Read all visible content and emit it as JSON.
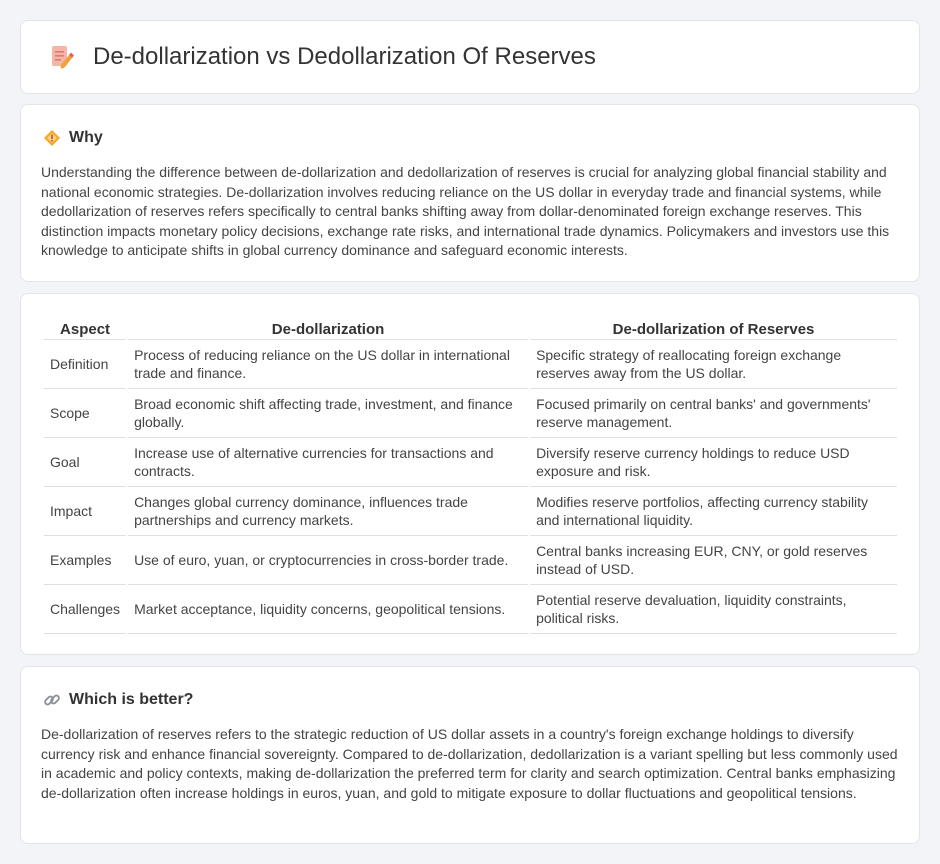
{
  "title": "De-dollarization vs Dedollarization Of Reserves",
  "why": {
    "heading": "Why",
    "body": "Understanding the difference between de-dollarization and dedollarization of reserves is crucial for analyzing global financial stability and national economic strategies. De-dollarization involves reducing reliance on the US dollar in everyday trade and financial systems, while dedollarization of reserves refers specifically to central banks shifting away from dollar-denominated foreign exchange reserves. This distinction impacts monetary policy decisions, exchange rate risks, and international trade dynamics. Policymakers and investors use this knowledge to anticipate shifts in global currency dominance and safeguard economic interests."
  },
  "table": {
    "headers": [
      "Aspect",
      "De-dollarization",
      "De-dollarization of Reserves"
    ],
    "rows": [
      [
        "Definition",
        "Process of reducing reliance on the US dollar in international trade and finance.",
        "Specific strategy of reallocating foreign exchange reserves away from the US dollar."
      ],
      [
        "Scope",
        "Broad economic shift affecting trade, investment, and finance globally.",
        "Focused primarily on central banks' and governments' reserve management."
      ],
      [
        "Goal",
        "Increase use of alternative currencies for transactions and contracts.",
        "Diversify reserve currency holdings to reduce USD exposure and risk."
      ],
      [
        "Impact",
        "Changes global currency dominance, influences trade partnerships and currency markets.",
        "Modifies reserve portfolios, affecting currency stability and international liquidity."
      ],
      [
        "Examples",
        "Use of euro, yuan, or cryptocurrencies in cross-border trade.",
        "Central banks increasing EUR, CNY, or gold reserves instead of USD."
      ],
      [
        "Challenges",
        "Market acceptance, liquidity concerns, geopolitical tensions.",
        "Potential reserve devaluation, liquidity constraints, political risks."
      ]
    ]
  },
  "better": {
    "heading": "Which is better?",
    "body": "De-dollarization of reserves refers to the strategic reduction of US dollar assets in a country's foreign exchange holdings to diversify currency risk and enhance financial sovereignty. Compared to de-dollarization, dedollarization is a variant spelling but less commonly used in academic and policy contexts, making de-dollarization the preferred term for clarity and search optimization. Central banks emphasizing de-dollarization often increase holdings in euros, yuan, and gold to mitigate exposure to dollar fluctuations and geopolitical tensions."
  },
  "icons": {
    "title": "document-pencil-icon",
    "why": "diamond-warning-icon",
    "better": "link-icon"
  }
}
